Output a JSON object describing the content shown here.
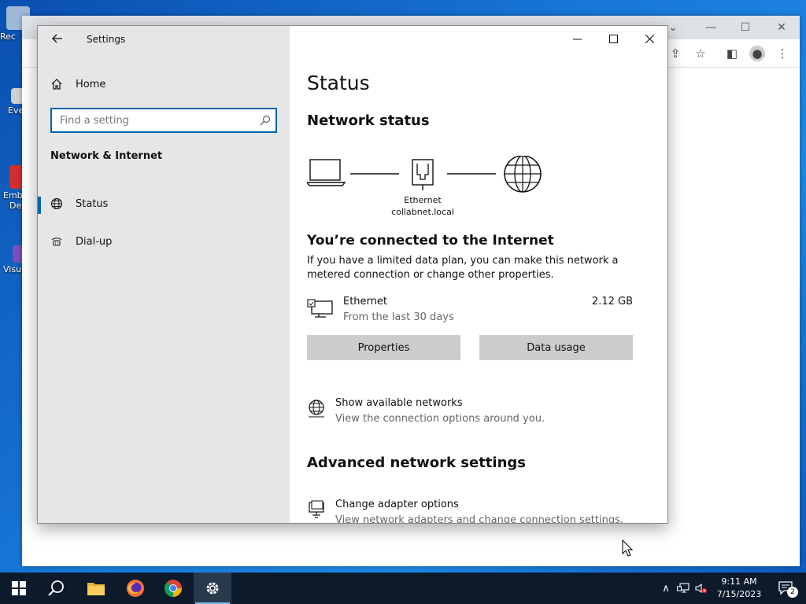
{
  "desktop": {
    "icons": [
      {
        "label": "Rec",
        "color": "#9fb8d8"
      },
      {
        "label": "Eve",
        "color": "#d0d0d0"
      },
      {
        "label": "Emb",
        "label2": "De",
        "color": "#d32f2f"
      },
      {
        "label": "Visu",
        "color": "#7b4fbf"
      }
    ]
  },
  "window": {
    "title": "Settings",
    "back_icon": "back-arrow-icon",
    "controls": {
      "minimize": "minimize-icon",
      "maximize": "maximize-icon",
      "close": "close-icon"
    }
  },
  "sidebar": {
    "home_label": "Home",
    "search_placeholder": "Find a setting",
    "section_title": "Network & Internet",
    "items": [
      {
        "label": "Status",
        "icon": "globe-icon",
        "active": true
      },
      {
        "label": "Dial-up",
        "icon": "dialup-icon",
        "active": false
      }
    ]
  },
  "main": {
    "page_title": "Status",
    "network_status_heading": "Network status",
    "diagram": {
      "adapter_label": "Ethernet",
      "network_label": "collabnet.local"
    },
    "connected_heading": "You’re connected to the Internet",
    "connected_desc": "If you have a limited data plan, you can make this network a metered connection or change other properties.",
    "ethernet": {
      "name": "Ethernet",
      "sub": "From the last 30 days",
      "usage": "2.12 GB"
    },
    "buttons": {
      "properties": "Properties",
      "data_usage": "Data usage"
    },
    "show_networks": {
      "title": "Show available networks",
      "desc": "View the connection options around you."
    },
    "advanced_heading": "Advanced network settings",
    "adapter_options": {
      "title": "Change adapter options",
      "desc": "View network adapters and change connection settings."
    }
  },
  "taskbar": {
    "time": "9:11 AM",
    "date": "7/15/2023",
    "notification_count": "2",
    "colors": {
      "accent": "#0063b1",
      "taskbar": "#0c1a2b"
    }
  }
}
